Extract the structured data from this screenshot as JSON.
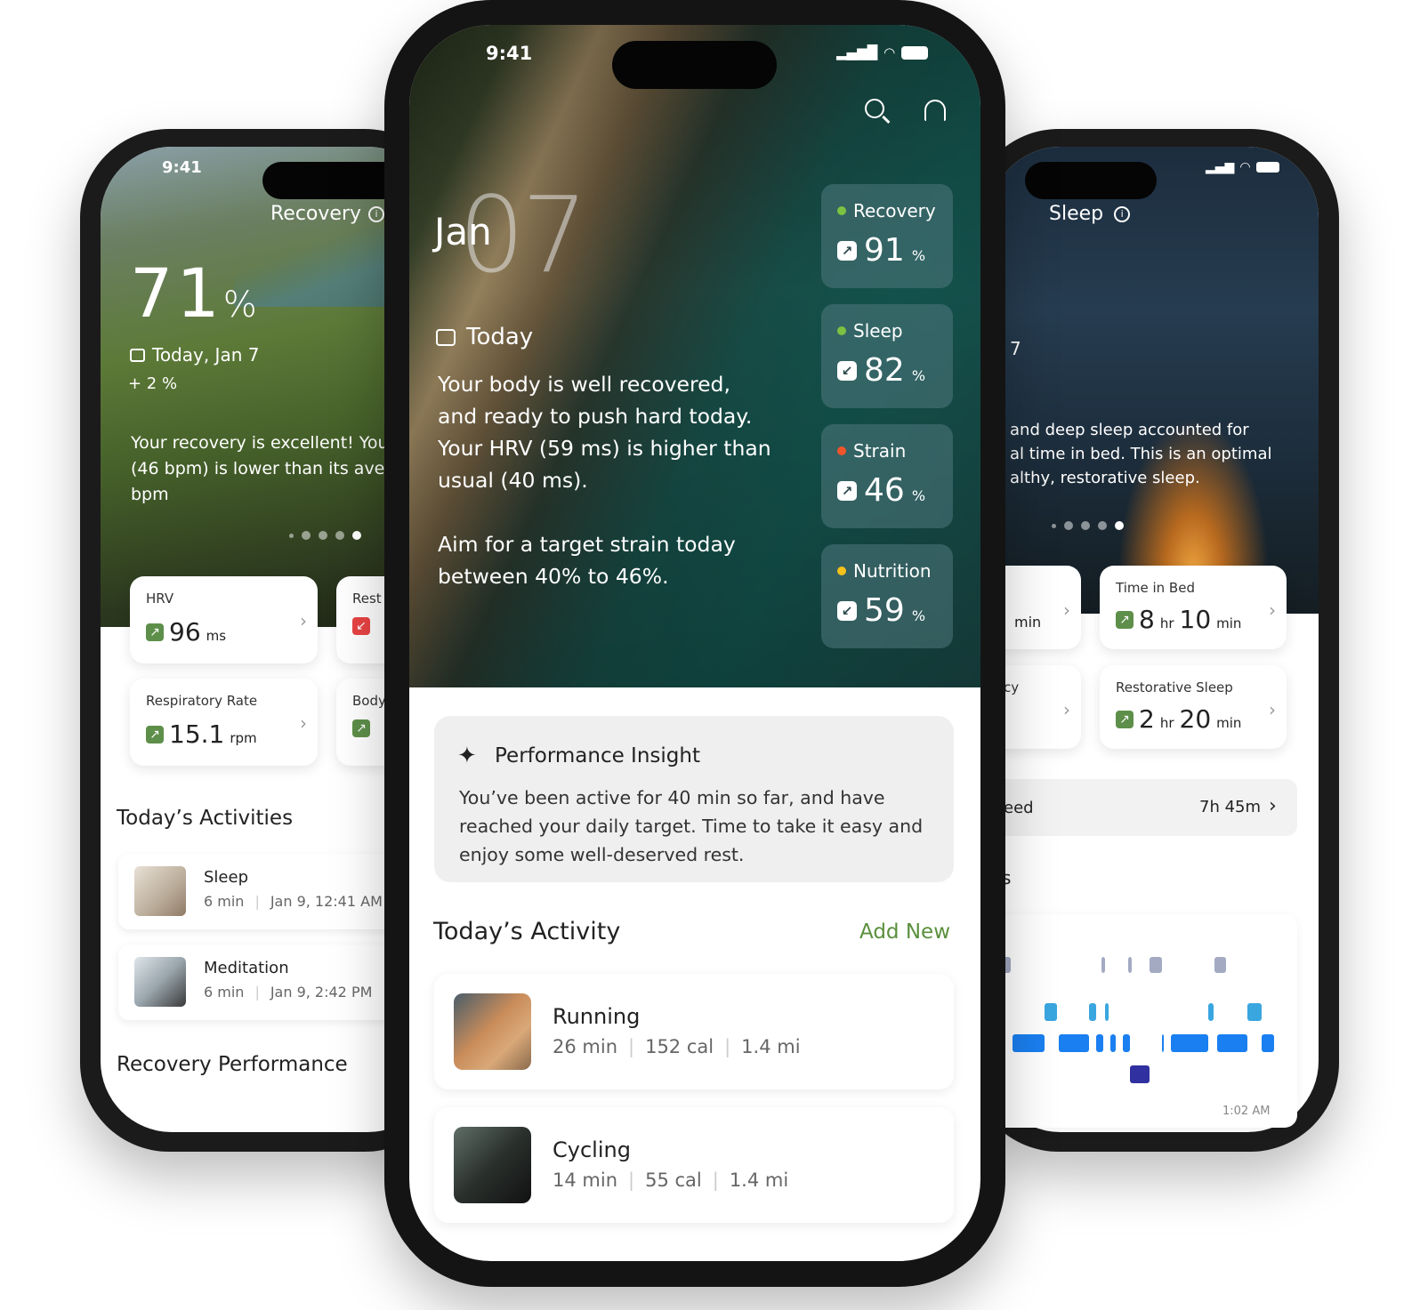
{
  "left_phone": {
    "time": "9:41",
    "title": "Recovery",
    "score": "71",
    "score_unit": "%",
    "date": "Today, Jan 7",
    "change": "+ 2 %",
    "description": "Your recovery is excellent! Your (46 bpm) is lower than its ave bpm",
    "description_lines": [
      "Your recovery is excellent! You",
      "(46 bpm) is lower than its ave",
      "bpm"
    ],
    "metrics": [
      {
        "label": "HRV",
        "value": "96",
        "unit": "ms",
        "trend": "up"
      },
      {
        "label": "Rest",
        "trend": "down"
      },
      {
        "label": "Respiratory Rate",
        "value": "15.1",
        "unit": "rpm",
        "trend": "up"
      },
      {
        "label": "Body",
        "trend": "up"
      }
    ],
    "activities_title": "Today’s Activities",
    "activities": [
      {
        "name": "Sleep",
        "duration": "6 min",
        "time": "Jan 9, 12:41 AM"
      },
      {
        "name": "Meditation",
        "duration": "6 min",
        "time": "Jan 9, 2:42 PM"
      }
    ],
    "performance_title": "Recovery Performance"
  },
  "center_phone": {
    "time": "9:41",
    "month": "Jan",
    "day": "07",
    "today_label": "Today",
    "message": [
      "Your body is well recovered,",
      "and ready to push hard today.",
      "Your HRV (59 ms) is higher than",
      "usual (40 ms)."
    ],
    "target": [
      "Aim for a target strain today",
      "between 40% to 46%."
    ],
    "scores": [
      {
        "label": "Recovery",
        "value": "91",
        "unit": "%",
        "trend": "up",
        "color": "#7cc242"
      },
      {
        "label": "Sleep",
        "value": "82",
        "unit": "%",
        "trend": "down",
        "color": "#7cc242"
      },
      {
        "label": "Strain",
        "value": "46",
        "unit": "%",
        "trend": "up",
        "color": "#f0542a"
      },
      {
        "label": "Nutrition",
        "value": "59",
        "unit": "%",
        "trend": "down",
        "color": "#f4c21b"
      }
    ],
    "insight": {
      "title": "Performance Insight",
      "text": "You’ve been active for 40 min so far, and have reached your daily target. Time to take it easy and enjoy some well-deserved rest."
    },
    "activity_title": "Today’s Activity",
    "add_new": "Add New",
    "activities": [
      {
        "name": "Running",
        "duration": "26 min",
        "calories": "152 cal",
        "distance": "1.4 mi"
      },
      {
        "name": "Cycling",
        "duration": "14 min",
        "calories": "55 cal",
        "distance": "1.4 mi"
      }
    ],
    "accent_color": "#5a8f3c"
  },
  "right_phone": {
    "title": "Sleep",
    "date_fragment": "7",
    "description_lines": [
      "and deep sleep accounted for",
      "al time in bed. This is an optimal",
      "althy, restorative sleep."
    ],
    "metrics": [
      {
        "label": "",
        "value_fragment": "min"
      },
      {
        "label": "Time in Bed",
        "hours": "8",
        "minutes": "10",
        "hr_unit": "hr",
        "min_unit": "min",
        "trend": "up"
      },
      {
        "label": "cy"
      },
      {
        "label": "Restorative Sleep",
        "hours": "2",
        "minutes": "20",
        "hr_unit": "hr",
        "min_unit": "min",
        "trend": "up"
      }
    ],
    "need_row": {
      "label": "eed",
      "value": "7h 45m"
    },
    "section_fragment": "s",
    "chart_time_label": "1:02 AM"
  }
}
